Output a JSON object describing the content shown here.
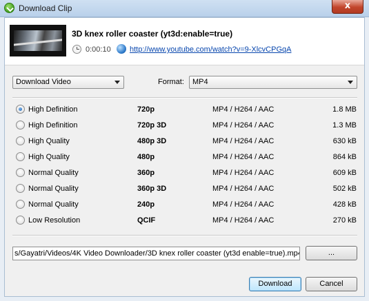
{
  "window": {
    "title": "Download Clip",
    "close_label": "x"
  },
  "clip": {
    "title": "3D knex roller coaster (yt3d:enable=true)",
    "duration": "0:00:10",
    "url": "http://www.youtube.com/watch?v=9-XlcvCPGqA"
  },
  "mode_select": {
    "value": "Download Video"
  },
  "format": {
    "label": "Format:",
    "value": "MP4"
  },
  "options": [
    {
      "quality": "High Definition",
      "resolution": "720p",
      "codec": "MP4 / H264 / AAC",
      "size": "1.8 MB",
      "selected": true
    },
    {
      "quality": "High Definition",
      "resolution": "720p 3D",
      "codec": "MP4 / H264 / AAC",
      "size": "1.3 MB",
      "selected": false
    },
    {
      "quality": "High Quality",
      "resolution": "480p 3D",
      "codec": "MP4 / H264 / AAC",
      "size": "630 kB",
      "selected": false
    },
    {
      "quality": "High Quality",
      "resolution": "480p",
      "codec": "MP4 / H264 / AAC",
      "size": "864 kB",
      "selected": false
    },
    {
      "quality": "Normal Quality",
      "resolution": "360p",
      "codec": "MP4 / H264 / AAC",
      "size": "609 kB",
      "selected": false
    },
    {
      "quality": "Normal Quality",
      "resolution": "360p 3D",
      "codec": "MP4 / H264 / AAC",
      "size": "502 kB",
      "selected": false
    },
    {
      "quality": "Normal Quality",
      "resolution": "240p",
      "codec": "MP4 / H264 / AAC",
      "size": "428 kB",
      "selected": false
    },
    {
      "quality": "Low Resolution",
      "resolution": "QCIF",
      "codec": "MP4 / H264 / AAC",
      "size": "270 kB",
      "selected": false
    }
  ],
  "save_path": {
    "value": "s/Gayatri/Videos/4K Video Downloader/3D knex roller coaster (yt3d enable=true).mp4"
  },
  "buttons": {
    "browse": "...",
    "download": "Download",
    "cancel": "Cancel"
  }
}
